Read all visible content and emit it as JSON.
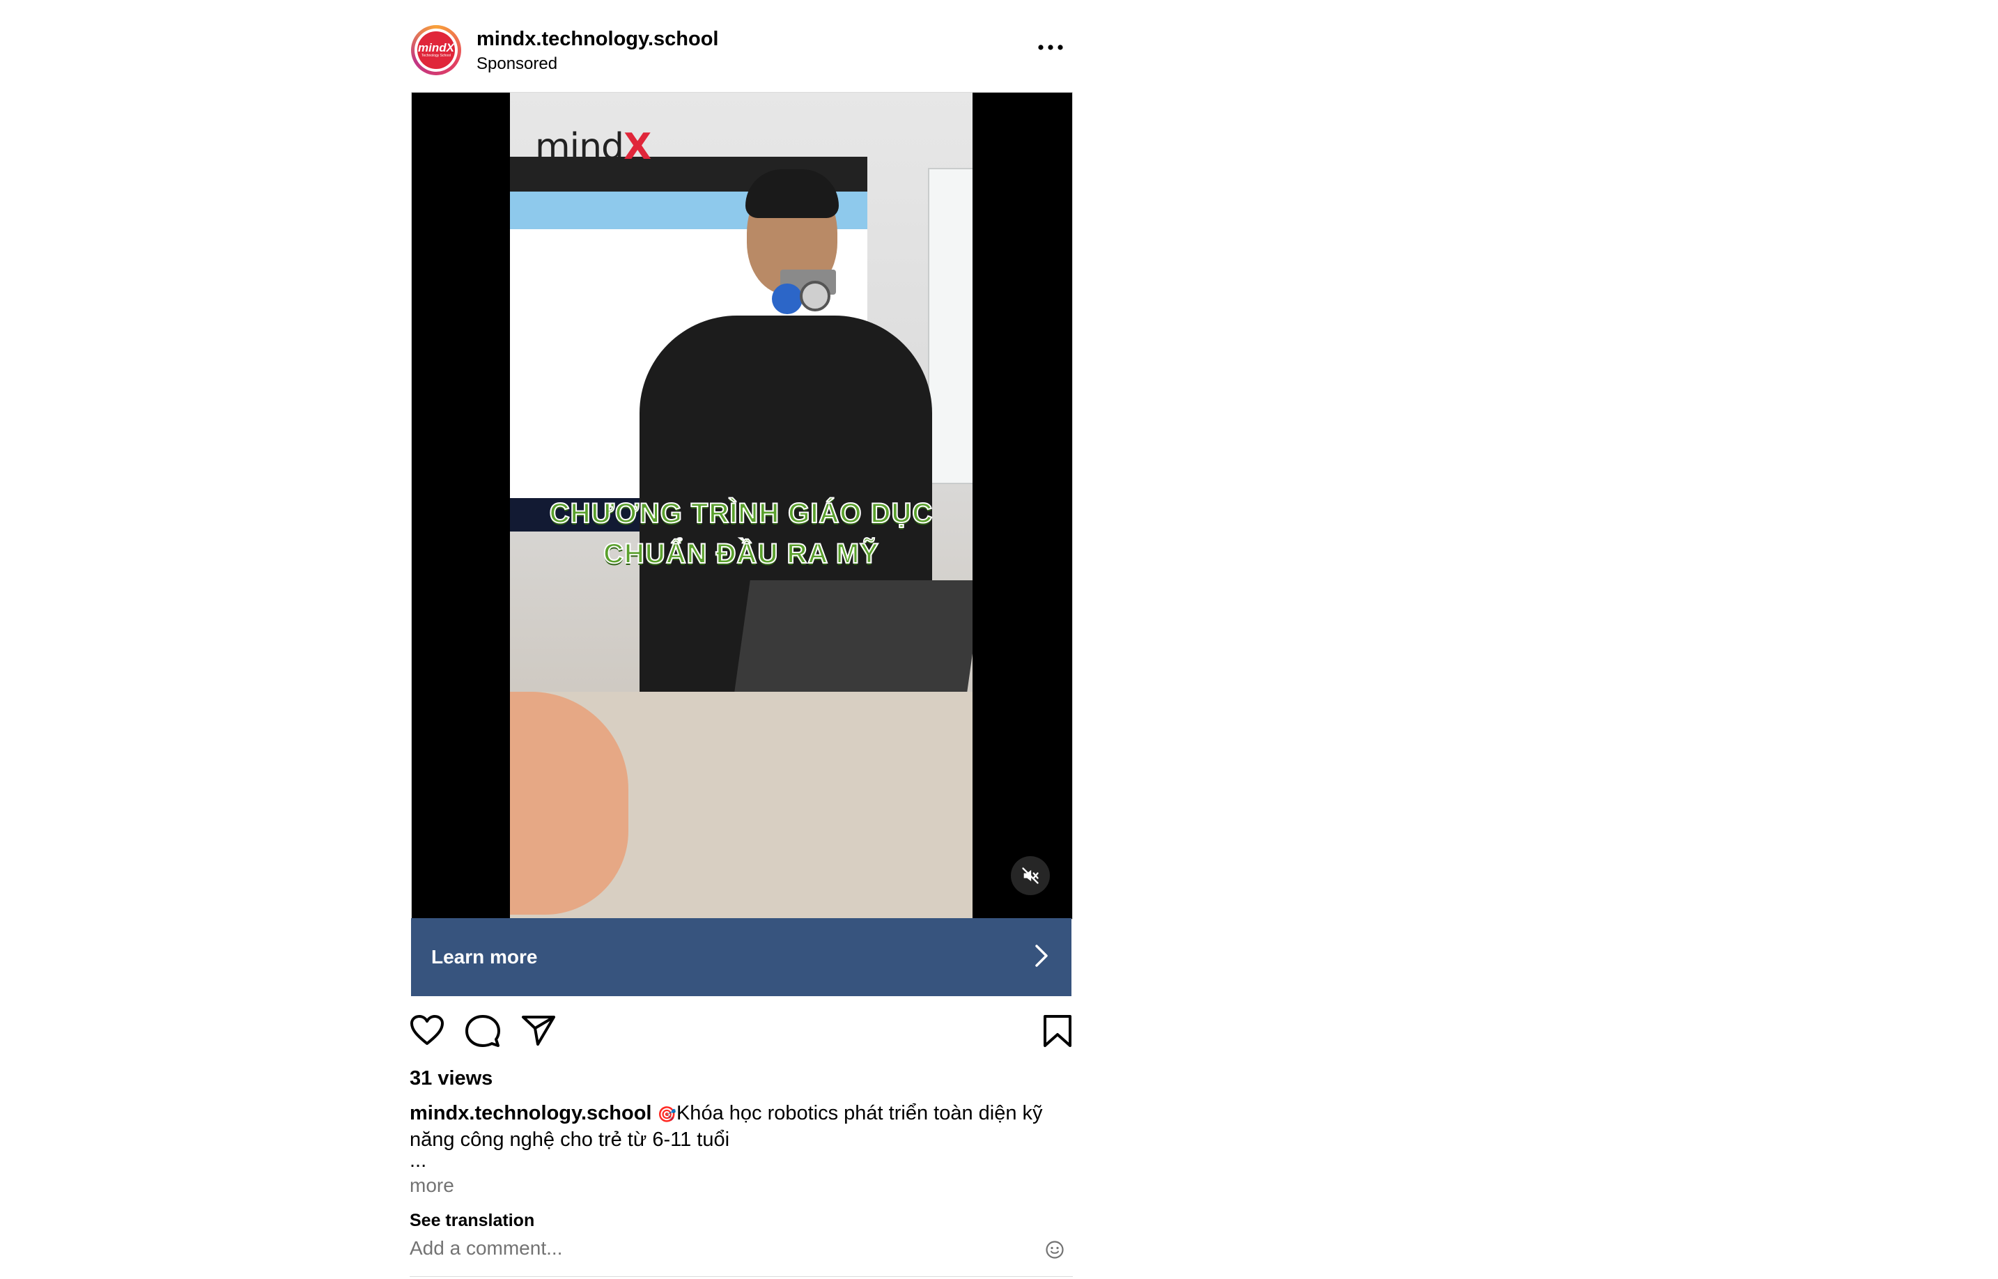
{
  "post": {
    "username": "mindx.technology.school",
    "sponsored_label": "Sponsored",
    "avatar_logo_text": "mindX",
    "avatar_logo_subtext": "Technology School"
  },
  "video": {
    "brand_watermark_prefix": "mind",
    "brand_watermark_suffix": "X",
    "overlay_line_1": "CHƯƠNG TRÌNH GIÁO DỤC",
    "overlay_line_2": "CHUẨN ĐẦU RA MỸ",
    "muted": true
  },
  "cta": {
    "label": "Learn more"
  },
  "actions": {
    "like_icon": "heart-icon",
    "comment_icon": "comment-icon",
    "share_icon": "paper-plane-icon",
    "save_icon": "bookmark-icon"
  },
  "stats": {
    "views": "31 views"
  },
  "caption": {
    "username": "mindx.technology.school",
    "emoji": "🎯",
    "text": "Khóa học robotics phát triển toàn diện kỹ năng công nghệ cho trẻ từ 6-11 tuổi",
    "ellipsis": "...",
    "more_label": "more",
    "see_translation": "See translation"
  },
  "comment": {
    "placeholder": "Add a comment..."
  },
  "colors": {
    "cta_background": "#37547e",
    "overlay_text_green": "#5aa02c",
    "brand_red": "#e0263a"
  }
}
